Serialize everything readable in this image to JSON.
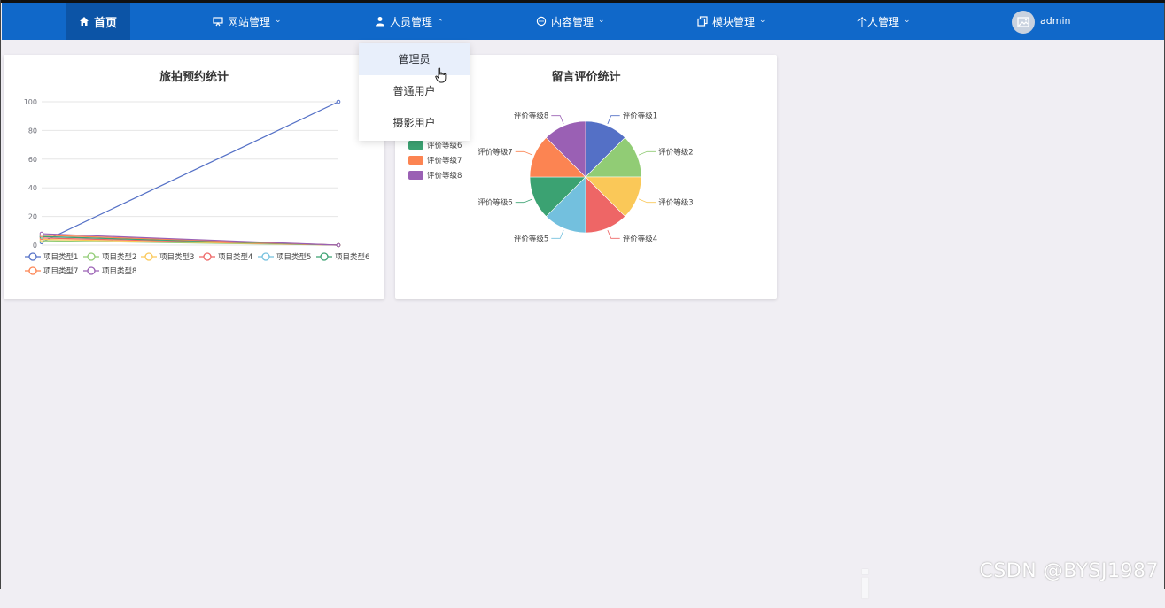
{
  "nav": {
    "home": "首页",
    "items": [
      {
        "label": "网站管理"
      },
      {
        "label": "人员管理"
      },
      {
        "label": "内容管理"
      },
      {
        "label": "模块管理"
      },
      {
        "label": "个人管理"
      }
    ],
    "user": "admin",
    "accent": "#1068c9"
  },
  "dropdown": {
    "items": [
      "管理员",
      "普通用户",
      "摄影用户"
    ],
    "active_index": 0
  },
  "watermark": "CSDN @BYSJ1987",
  "chart_data": [
    {
      "type": "line",
      "title": "旅拍预约统计",
      "x": [
        "",
        ""
      ],
      "ylim": [
        0,
        100
      ],
      "yticks": [
        0,
        20,
        40,
        60,
        80,
        100
      ],
      "grid": true,
      "legend_position": "bottom-left",
      "series": [
        {
          "name": "项目类型1",
          "color": "#5470c6",
          "values": [
            2,
            100
          ]
        },
        {
          "name": "项目类型2",
          "color": "#91cc75",
          "values": [
            3,
            0
          ]
        },
        {
          "name": "项目类型3",
          "color": "#fac858",
          "values": [
            4,
            0
          ]
        },
        {
          "name": "项目类型4",
          "color": "#ee6666",
          "values": [
            5,
            0
          ]
        },
        {
          "name": "项目类型5",
          "color": "#73c0de",
          "values": [
            6,
            0
          ]
        },
        {
          "name": "项目类型6",
          "color": "#3ba272",
          "values": [
            6,
            0
          ]
        },
        {
          "name": "项目类型7",
          "color": "#fc8452",
          "values": [
            7,
            0
          ]
        },
        {
          "name": "项目类型8",
          "color": "#9a60b4",
          "values": [
            8,
            0
          ]
        }
      ]
    },
    {
      "type": "pie",
      "title": "留言评价统计",
      "legend_position": "left",
      "legend_visible": [
        "评价等级6",
        "评价等级7",
        "评价等级8"
      ],
      "slices": [
        {
          "name": "评价等级1",
          "value": 1,
          "color": "#5470c6"
        },
        {
          "name": "评价等级2",
          "value": 1,
          "color": "#91cc75"
        },
        {
          "name": "评价等级3",
          "value": 1,
          "color": "#fac858"
        },
        {
          "name": "评价等级4",
          "value": 1,
          "color": "#ee6666"
        },
        {
          "name": "评价等级5",
          "value": 1,
          "color": "#73c0de"
        },
        {
          "name": "评价等级6",
          "value": 1,
          "color": "#3ba272"
        },
        {
          "name": "评价等级7",
          "value": 1,
          "color": "#fc8452"
        },
        {
          "name": "评价等级8",
          "value": 1,
          "color": "#9a60b4"
        }
      ]
    }
  ]
}
